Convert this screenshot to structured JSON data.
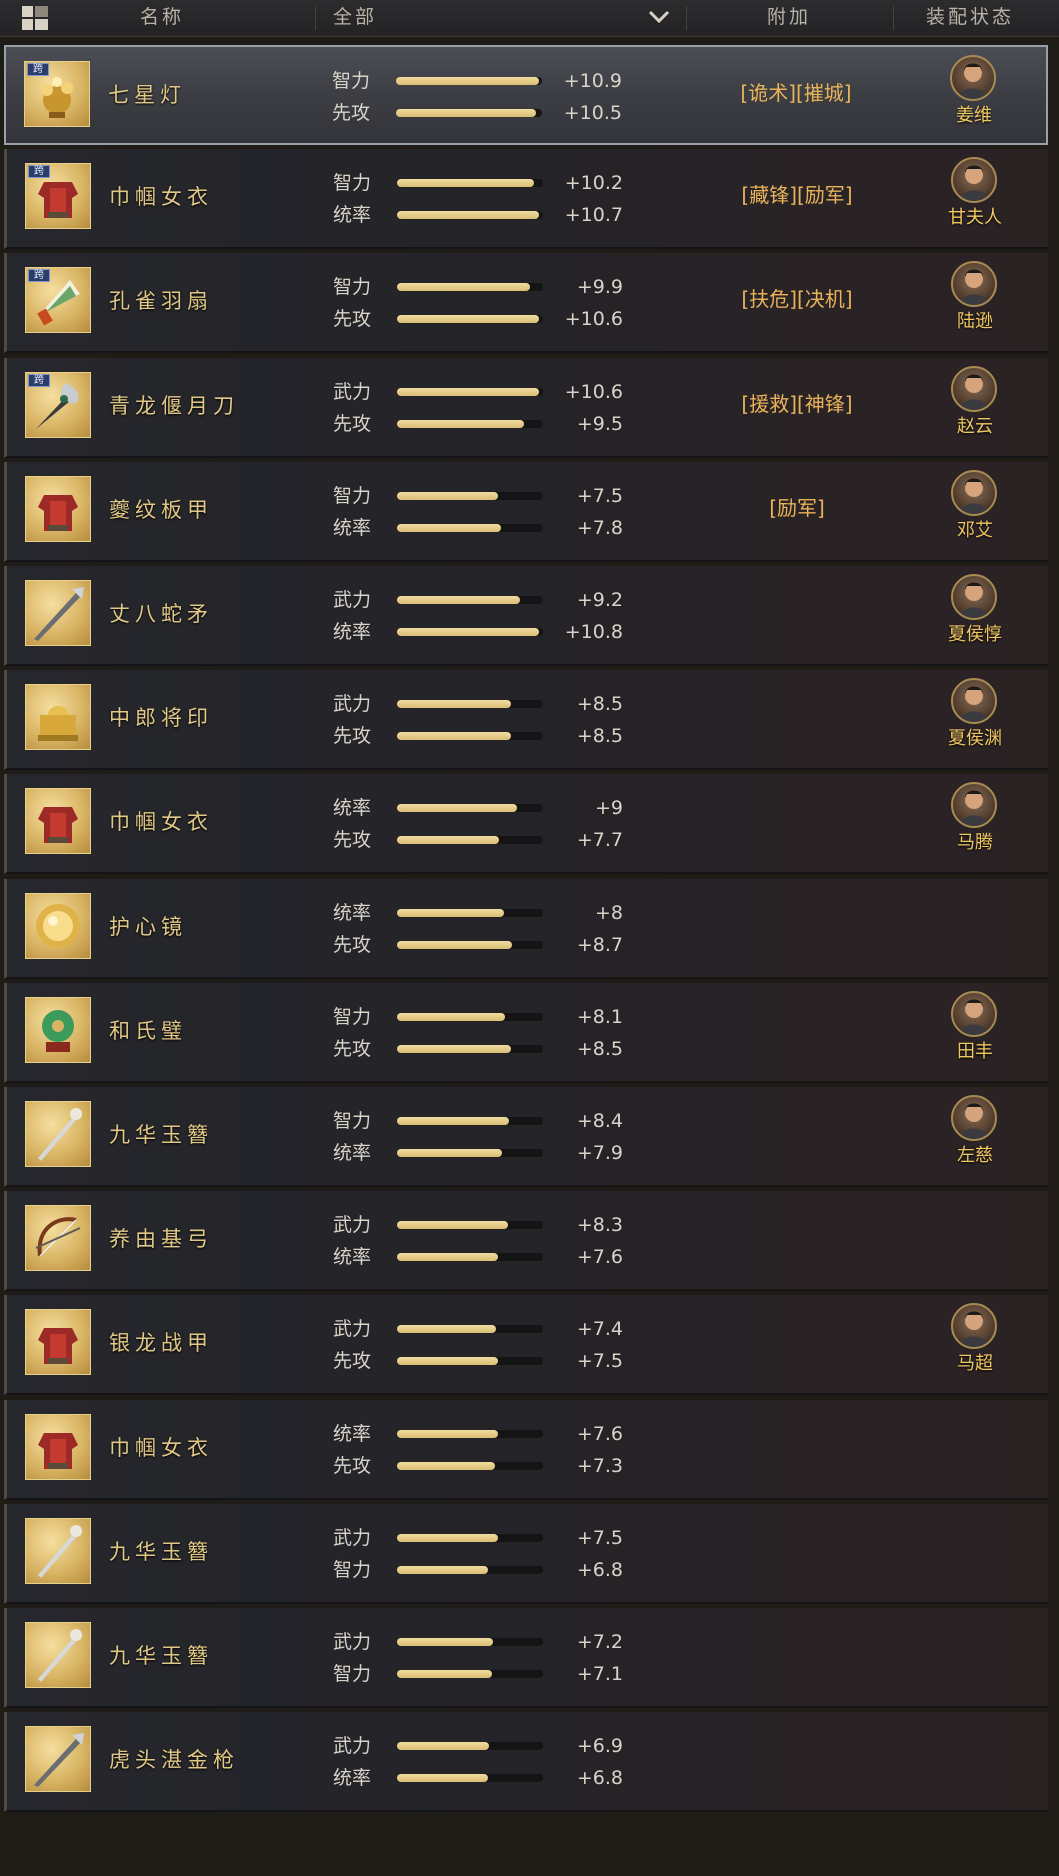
{
  "header": {
    "name_col": "名称",
    "filter_value": "全部",
    "bonus_col": "附加",
    "equip_col": "装配状态"
  },
  "icons": {
    "grid": "grid-layout-icon",
    "dropdown": "chevron-down-icon",
    "cross_badge": "跨"
  },
  "colors": {
    "item_name": "#e2c886",
    "bonus": "#e9b35a",
    "general_name": "#f0c860",
    "bar_fill": "#f1dca0"
  },
  "rows": [
    {
      "name": "七星灯",
      "cross": true,
      "selected": true,
      "icon": "lamp-icon",
      "s1": {
        "label": "智力",
        "value": "+10.9",
        "fill": 0.98
      },
      "s2": {
        "label": "先攻",
        "value": "+10.5",
        "fill": 0.96
      },
      "bonus": [
        "[诡术]",
        "[摧城]"
      ],
      "general": "姜维"
    },
    {
      "name": "巾帼女衣",
      "cross": true,
      "selected": false,
      "icon": "armor-icon",
      "s1": {
        "label": "智力",
        "value": "+10.2",
        "fill": 0.94
      },
      "s2": {
        "label": "统率",
        "value": "+10.7",
        "fill": 0.97
      },
      "bonus": [
        "[藏锋]",
        "[励军]"
      ],
      "general": "甘夫人"
    },
    {
      "name": "孔雀羽扇",
      "cross": true,
      "selected": false,
      "icon": "fan-icon",
      "s1": {
        "label": "智力",
        "value": "+9.9",
        "fill": 0.91
      },
      "s2": {
        "label": "先攻",
        "value": "+10.6",
        "fill": 0.97
      },
      "bonus": [
        "[扶危]",
        "[决机]"
      ],
      "general": "陆逊"
    },
    {
      "name": "青龙偃月刀",
      "cross": true,
      "selected": false,
      "icon": "glaive-icon",
      "s1": {
        "label": "武力",
        "value": "+10.6",
        "fill": 0.97
      },
      "s2": {
        "label": "先攻",
        "value": "+9.5",
        "fill": 0.87
      },
      "bonus": [
        "[援救]",
        "[神锋]"
      ],
      "general": "赵云"
    },
    {
      "name": "夔纹板甲",
      "cross": false,
      "selected": false,
      "icon": "armor-icon",
      "s1": {
        "label": "智力",
        "value": "+7.5",
        "fill": 0.69
      },
      "s2": {
        "label": "统率",
        "value": "+7.8",
        "fill": 0.71
      },
      "bonus": [
        "[励军]"
      ],
      "general": "邓艾"
    },
    {
      "name": "丈八蛇矛",
      "cross": false,
      "selected": false,
      "icon": "spear-icon",
      "s1": {
        "label": "武力",
        "value": "+9.2",
        "fill": 0.84
      },
      "s2": {
        "label": "统率",
        "value": "+10.8",
        "fill": 0.97
      },
      "bonus": [],
      "general": "夏侯惇"
    },
    {
      "name": "中郎将印",
      "cross": false,
      "selected": false,
      "icon": "seal-icon",
      "s1": {
        "label": "武力",
        "value": "+8.5",
        "fill": 0.78
      },
      "s2": {
        "label": "先攻",
        "value": "+8.5",
        "fill": 0.78
      },
      "bonus": [],
      "general": "夏侯渊"
    },
    {
      "name": "巾帼女衣",
      "cross": false,
      "selected": false,
      "icon": "armor-icon",
      "s1": {
        "label": "统率",
        "value": "+9",
        "fill": 0.82
      },
      "s2": {
        "label": "先攻",
        "value": "+7.7",
        "fill": 0.7
      },
      "bonus": [],
      "general": "马腾"
    },
    {
      "name": "护心镜",
      "cross": false,
      "selected": false,
      "icon": "mirror-icon",
      "s1": {
        "label": "统率",
        "value": "+8",
        "fill": 0.73
      },
      "s2": {
        "label": "先攻",
        "value": "+8.7",
        "fill": 0.79
      },
      "bonus": [],
      "general": ""
    },
    {
      "name": "和氏璧",
      "cross": false,
      "selected": false,
      "icon": "jade-icon",
      "s1": {
        "label": "智力",
        "value": "+8.1",
        "fill": 0.74
      },
      "s2": {
        "label": "先攻",
        "value": "+8.5",
        "fill": 0.78
      },
      "bonus": [],
      "general": "田丰"
    },
    {
      "name": "九华玉簪",
      "cross": false,
      "selected": false,
      "icon": "hairpin-icon",
      "s1": {
        "label": "智力",
        "value": "+8.4",
        "fill": 0.77
      },
      "s2": {
        "label": "统率",
        "value": "+7.9",
        "fill": 0.72
      },
      "bonus": [],
      "general": "左慈"
    },
    {
      "name": "养由基弓",
      "cross": false,
      "selected": false,
      "icon": "bow-icon",
      "s1": {
        "label": "武力",
        "value": "+8.3",
        "fill": 0.76
      },
      "s2": {
        "label": "统率",
        "value": "+7.6",
        "fill": 0.69
      },
      "bonus": [],
      "general": ""
    },
    {
      "name": "银龙战甲",
      "cross": false,
      "selected": false,
      "icon": "armor-icon",
      "s1": {
        "label": "武力",
        "value": "+7.4",
        "fill": 0.68
      },
      "s2": {
        "label": "先攻",
        "value": "+7.5",
        "fill": 0.69
      },
      "bonus": [],
      "general": "马超"
    },
    {
      "name": "巾帼女衣",
      "cross": false,
      "selected": false,
      "icon": "armor-icon",
      "s1": {
        "label": "统率",
        "value": "+7.6",
        "fill": 0.69
      },
      "s2": {
        "label": "先攻",
        "value": "+7.3",
        "fill": 0.67
      },
      "bonus": [],
      "general": ""
    },
    {
      "name": "九华玉簪",
      "cross": false,
      "selected": false,
      "icon": "hairpin-icon",
      "s1": {
        "label": "武力",
        "value": "+7.5",
        "fill": 0.69
      },
      "s2": {
        "label": "智力",
        "value": "+6.8",
        "fill": 0.62
      },
      "bonus": [],
      "general": ""
    },
    {
      "name": "九华玉簪",
      "cross": false,
      "selected": false,
      "icon": "hairpin-icon",
      "s1": {
        "label": "武力",
        "value": "+7.2",
        "fill": 0.66
      },
      "s2": {
        "label": "智力",
        "value": "+7.1",
        "fill": 0.65
      },
      "bonus": [],
      "general": ""
    },
    {
      "name": "虎头湛金枪",
      "cross": false,
      "selected": false,
      "icon": "spear-icon",
      "s1": {
        "label": "武力",
        "value": "+6.9",
        "fill": 0.63
      },
      "s2": {
        "label": "统率",
        "value": "+6.8",
        "fill": 0.62
      },
      "bonus": [],
      "general": ""
    }
  ]
}
